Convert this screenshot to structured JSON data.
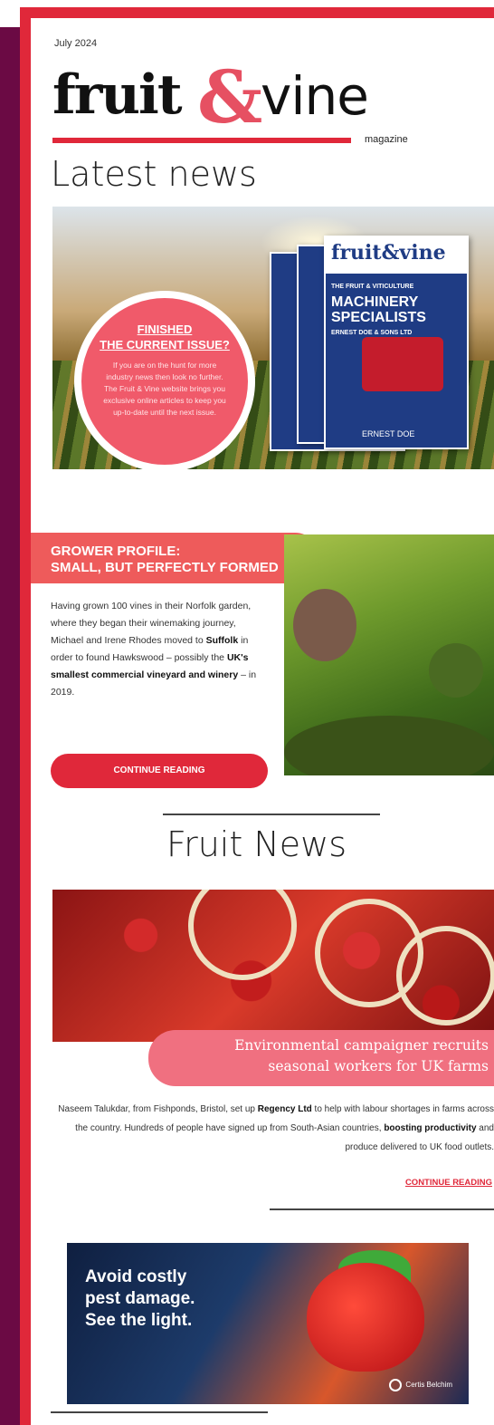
{
  "header": {
    "issue_date": "July 2024",
    "logo": {
      "word1": "fruit",
      "amp": "&",
      "word2": "vine",
      "sub": "magazine"
    },
    "section_title": "Latest news"
  },
  "hero": {
    "circle_title_1": "FINISHED",
    "circle_title_2": "THE CURRENT ISSUE?",
    "circle_body": "If you are on the hunt for more industry news then look no further. The Fruit & Vine website brings you exclusive online articles to keep you up-to-date until the next issue.",
    "mag_title": "fruit&vine",
    "mag_kicker": "THE FRUIT & VITICULTURE",
    "mag_headline_1": "MACHINERY",
    "mag_headline_2": "SPECIALISTS",
    "mag_sub": "ERNEST DOE & SONS LTD",
    "mag_brand": "ERNEST DOE"
  },
  "grower": {
    "banner_line1": "GROWER PROFILE:",
    "banner_line2": "SMALL, BUT PERFECTLY FORMED",
    "text_1": "Having grown 100 vines in their Norfolk garden, where they began their winemaking journey, Michael and Irene Rhodes moved to ",
    "bold_1": "Suffolk",
    "text_2": " in order to found Hawkswood – possibly the ",
    "bold_2": "UK's smallest commercial vineyard and winery",
    "text_3": " – in 2019.",
    "button": "CONTINUE READING"
  },
  "fruit": {
    "section_title": "Fruit News",
    "headline_1": "Environmental campaigner recruits",
    "headline_2": "seasonal workers for UK farms",
    "body_1": "Naseem Talukdar, from Fishponds, Bristol, set up ",
    "body_bold_1": "Regency Ltd",
    "body_2": " to help with labour shortages in farms across the country. Hundreds of people have signed up from South-Asian countries, ",
    "body_bold_2": "boosting productivity",
    "body_3": " and produce delivered to UK food outlets.",
    "link": "CONTINUE READING"
  },
  "ad": {
    "line1": "Avoid costly",
    "line2": "pest damage.",
    "line3": "See the light.",
    "brand": "Certis Belchim"
  },
  "colors": {
    "accent": "#e0283a",
    "sidebar": "#6b0a44",
    "coral": "#ee5b5b"
  }
}
